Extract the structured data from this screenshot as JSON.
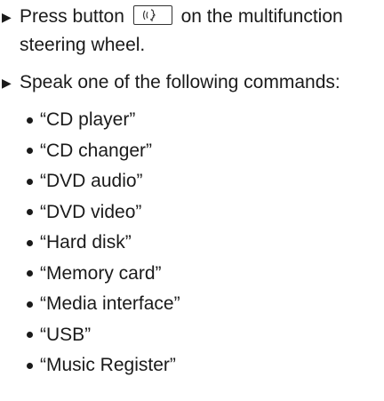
{
  "instructions": {
    "step1": {
      "text_before": "Press button",
      "button_icon": "voice-control-icon",
      "text_after": "on the multifunction",
      "line2": "steering wheel."
    },
    "step2": {
      "text": "Speak one of the following commands:"
    },
    "commands": [
      "“CD player”",
      "“CD changer”",
      "“DVD audio”",
      "“DVD video”",
      "“Hard disk”",
      "“Memory card”",
      "“Media interface”",
      "“USB”",
      "“Music Register”"
    ]
  }
}
